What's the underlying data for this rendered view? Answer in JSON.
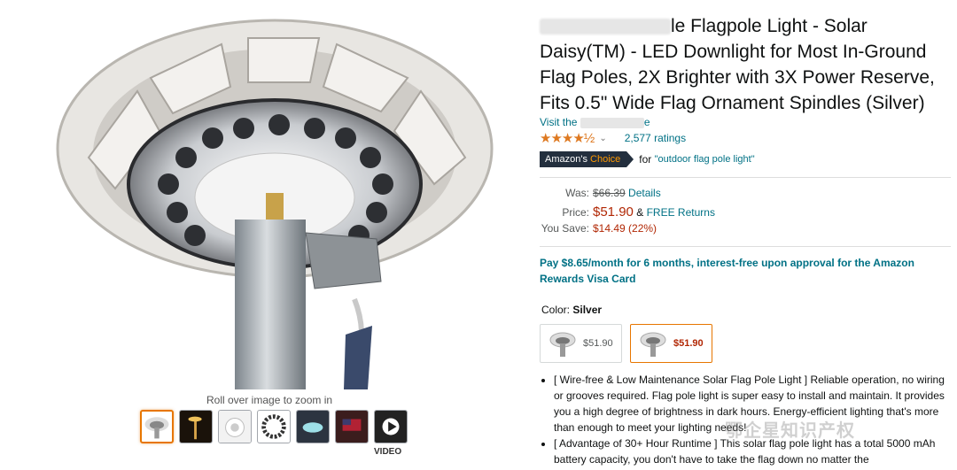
{
  "gallery": {
    "zoom_hint": "Roll over image to zoom in",
    "video_label": "VIDEO",
    "thumbnails": [
      "Solar flag pole light - top view",
      "Night lighting",
      "Light ring",
      "Bulb layout",
      "Installed",
      "Flag at night",
      "Video"
    ]
  },
  "product": {
    "title_visible": "le Flagpole Light - Solar Daisy(TM) - LED Downlight for Most In-Ground Flag Poles, 2X Brighter with 3X Power Reserve, Fits 0.5\" Wide Flag Ornament Spindles (Silver)",
    "visit_prefix": "Visit the",
    "visit_suffix": "e",
    "stars": "★★★★½",
    "ratings": "2,577 ratings",
    "badge_prefix": "Amazon's",
    "badge_choice": "Choice",
    "for_text": "for",
    "for_link": "\"outdoor flag pole light\""
  },
  "pricing": {
    "was_label": "Was:",
    "was_value": "$66.39",
    "details": "Details",
    "price_label": "Price:",
    "price_value": "$51.90",
    "free_returns_amp": "&",
    "free_returns": "FREE Returns",
    "save_label": "You Save:",
    "save_value": "$14.49 (22%)"
  },
  "payment": {
    "text": "Pay $8.65/month for 6 months, interest-free upon approval for the Amazon Rewards Visa Card"
  },
  "color": {
    "label": "Color:",
    "value": "Silver",
    "options": [
      {
        "price": "$51.90"
      },
      {
        "price": "$51.90"
      }
    ]
  },
  "bullets": [
    "[ Wire-free & Low Maintenance Solar Flag Pole Light ] Reliable operation, no wiring or grooves required. Flag pole light is super easy to install and maintain. It provides you a high degree of brightness in dark hours. Energy-efficient lighting that's more than enough to meet your lighting needs!",
    "[ Advantage of 30+ Hour Runtime ] This solar flag pole light has a total 5000 mAh battery capacity, you don't have to take the flag down no matter the"
  ],
  "watermark": "鄂企星知识产权",
  "colors": {
    "link": "#007185",
    "price": "#b12704",
    "star": "#de7921",
    "badge": "#232f3e",
    "selected": "#e77600"
  }
}
